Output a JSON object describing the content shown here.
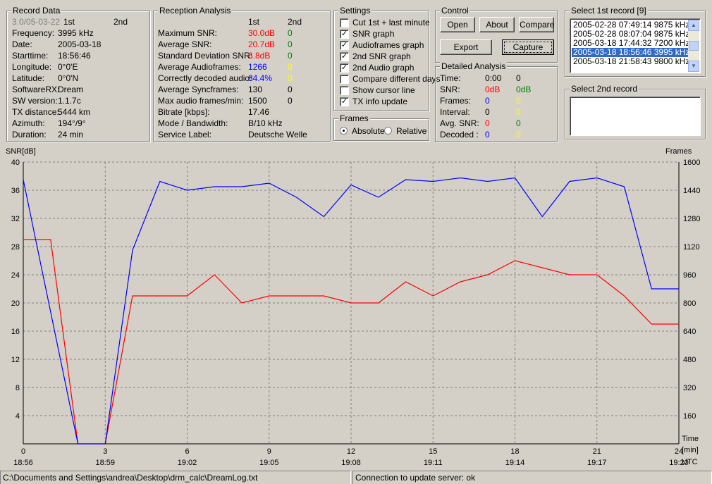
{
  "record_data": {
    "title": "Record Data",
    "version": "3.0/05-03-22",
    "col1": "1st",
    "col2": "2nd",
    "rows": [
      {
        "label": "Frequency:",
        "value": "3995 kHz"
      },
      {
        "label": "Date:",
        "value": "2005-03-18"
      },
      {
        "label": "Starttime:",
        "value": "18:56:46"
      },
      {
        "label": "Longitude:",
        "value": "0°0'E"
      },
      {
        "label": "Latitude:",
        "value": "0°0'N"
      },
      {
        "label": "SoftwareRX:",
        "value": "Dream"
      },
      {
        "label": "SW version:",
        "value": "1.1.7c"
      },
      {
        "label": "TX distance:",
        "value": "5444 km"
      },
      {
        "label": "Azimuth:",
        "value": "194°/9°"
      },
      {
        "label": "Duration:",
        "value": "24 min"
      }
    ]
  },
  "reception": {
    "title": "Reception Analysis",
    "col1": "1st",
    "col2": "2nd",
    "rows": [
      {
        "label": "Maximum SNR:",
        "v1": "30.0dB",
        "v2": "0"
      },
      {
        "label": "Average SNR:",
        "v1": "20.7dB",
        "v2": "0"
      },
      {
        "label": "Standard Deviation SNR:",
        "v1": "6.8dB",
        "v2": "0"
      },
      {
        "label": "Average Audioframes:",
        "v1": "1266",
        "v2": "0"
      },
      {
        "label": "Correctly decoded audio:",
        "v1": "84.4%",
        "v2": "0"
      },
      {
        "label": "Average Syncframes:",
        "v1": "130",
        "v2": "0"
      },
      {
        "label": "Max audio frames/min:",
        "v1": "1500",
        "v2": "0"
      },
      {
        "label": "Bitrate [kbps]:",
        "v1": "17.46",
        "v2": ""
      },
      {
        "label": "Mode / Bandwidth:",
        "v1": "B/10 kHz",
        "v2": ""
      },
      {
        "label": "Service Label:",
        "v1": "Deutsche Welle",
        "v2": ""
      }
    ]
  },
  "settings": {
    "title": "Settings",
    "items": [
      {
        "label": "Cut 1st + last minute",
        "checked": false
      },
      {
        "label": "SNR graph",
        "checked": true
      },
      {
        "label": "Audioframes graph",
        "checked": true
      },
      {
        "label": "2nd SNR graph",
        "checked": true
      },
      {
        "label": "2nd Audio graph",
        "checked": true
      },
      {
        "label": "Compare different days",
        "checked": false
      },
      {
        "label": "Show cursor line",
        "checked": false
      },
      {
        "label": "TX info update",
        "checked": true
      }
    ]
  },
  "frames": {
    "title": "Frames",
    "absolute": "Absolute",
    "relative": "Relative"
  },
  "control": {
    "title": "Control",
    "open": "Open",
    "about": "About",
    "compare": "Compare",
    "export": "Export",
    "capture": "Capture"
  },
  "detailed": {
    "title": "Detailed Analysis",
    "rows": [
      {
        "label": "Time:",
        "v1": "0:00",
        "v2": "0"
      },
      {
        "label": "SNR:",
        "v1": "0dB",
        "v2": "0dB"
      },
      {
        "label": "Frames:",
        "v1": "0",
        "v2": "0"
      },
      {
        "label": "Interval:",
        "v1": "0",
        "v2": "0"
      },
      {
        "label": "Avg. SNR:",
        "v1": "0",
        "v2": "0"
      },
      {
        "label": "Decoded :",
        "v1": "0",
        "v2": "0"
      }
    ]
  },
  "select1": {
    "title": "Select 1st record [9]",
    "items": [
      "2005-02-28 07:49:14 9875 kHz",
      "2005-02-28 08:07:04 9875 kHz",
      "2005-03-18 17:44:32 7200 kHz",
      "2005-03-18 18:56:46 3995 kHz",
      "2005-03-18 21:58:43 9800 kHz"
    ],
    "selected_index": 3
  },
  "select2": {
    "title": "Select 2nd record"
  },
  "colors": {
    "red": "#ff0000",
    "green": "#008000",
    "blue": "#0000ff",
    "yellow": "#ffff00",
    "snr_line": "#0000ff",
    "frames_line": "#ff0000",
    "selection": "#316ac5"
  },
  "chart_data": {
    "type": "line",
    "ylabel_left": "SNR[dB]",
    "ylabel_right": "Frames",
    "xlabel_top": "Time",
    "xlabel_unit": "[min]",
    "xlabel_tz": "UTC",
    "ylim_left": [
      0,
      40
    ],
    "ylim_right": [
      0,
      1600
    ],
    "xlim": [
      0,
      24
    ],
    "yticks_left": [
      4,
      8,
      12,
      16,
      20,
      24,
      28,
      32,
      36,
      40
    ],
    "yticks_right": [
      160,
      320,
      480,
      640,
      800,
      960,
      1120,
      1280,
      1440,
      1600
    ],
    "xticks": [
      0,
      3,
      6,
      9,
      12,
      15,
      18,
      21,
      24
    ],
    "xticks_time": [
      "18:56",
      "18:59",
      "19:02",
      "19:05",
      "19:08",
      "19:11",
      "19:14",
      "19:17",
      "19:20"
    ],
    "grid": true,
    "series": [
      {
        "axis": "left",
        "color": "#ff0000",
        "x": [
          0,
          1,
          2,
          3,
          4,
          5,
          6,
          7,
          8,
          9,
          10,
          11,
          12,
          13,
          14,
          15,
          16,
          17,
          18,
          19,
          20,
          21,
          22,
          23,
          24
        ],
        "y": [
          29,
          29,
          0,
          0,
          21,
          21,
          21,
          24,
          20,
          21,
          21,
          21,
          20,
          20,
          23,
          21,
          23,
          24,
          26,
          25,
          24,
          24,
          21,
          17,
          17
        ]
      },
      {
        "axis": "right",
        "color": "#0000ff",
        "x": [
          0,
          2,
          3,
          4,
          5,
          6,
          7,
          8,
          9,
          10,
          11,
          12,
          13,
          14,
          15,
          16,
          17,
          18,
          19,
          20,
          21,
          22,
          23,
          24
        ],
        "y": [
          1500,
          0,
          0,
          1100,
          1490,
          1440,
          1460,
          1460,
          1480,
          1400,
          1290,
          1470,
          1400,
          1500,
          1490,
          1510,
          1490,
          1510,
          1290,
          1490,
          1510,
          1460,
          880,
          880
        ]
      }
    ]
  },
  "status": {
    "path": "C:\\Documents and Settings\\andrea\\Desktop\\drm_calc\\DreamLog.txt",
    "server": "Connection to update server: ok"
  }
}
